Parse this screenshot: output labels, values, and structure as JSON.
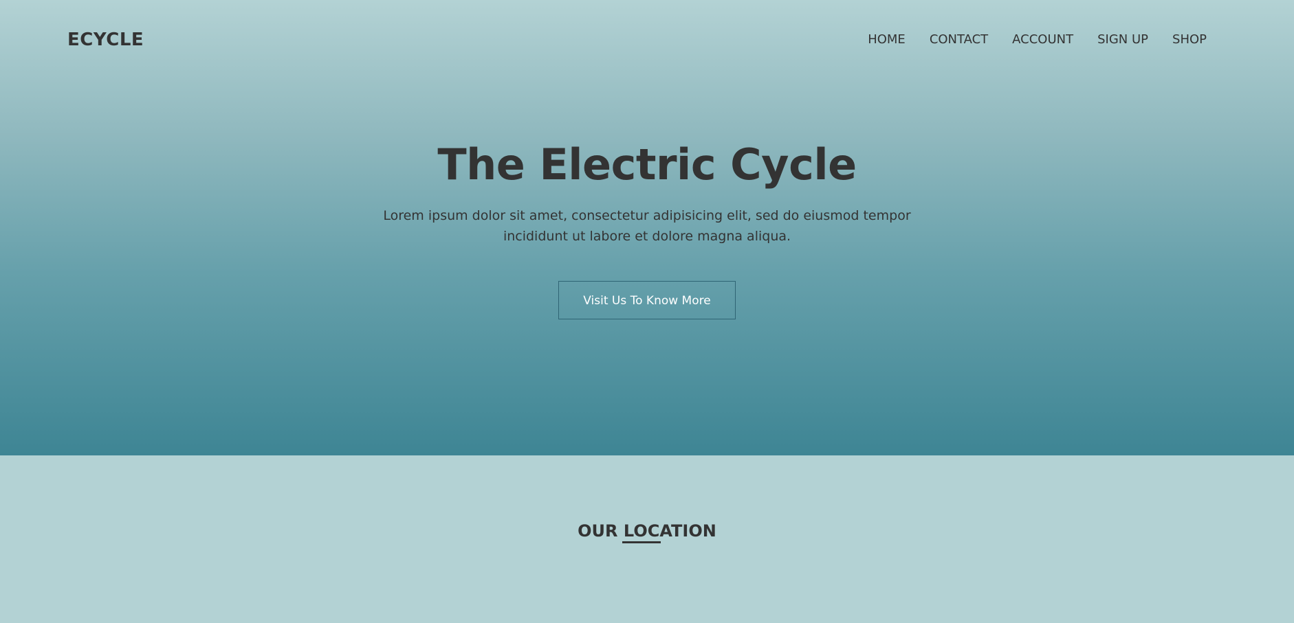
{
  "brand": {
    "logo": "ECYCLE"
  },
  "nav": {
    "items": [
      {
        "label": "HOME"
      },
      {
        "label": "CONTACT"
      },
      {
        "label": "ACCOUNT"
      },
      {
        "label": "SIGN UP"
      },
      {
        "label": "SHOP"
      }
    ]
  },
  "hero": {
    "title": "The Electric Cycle",
    "subtitle": "Lorem ipsum dolor sit amet, consectetur adipisicing elit, sed do eiusmod tempor incididunt ut labore et dolore magna aliqua.",
    "button_label": "Visit Us To Know More"
  },
  "location": {
    "title": "OUR LOCATION"
  },
  "colors": {
    "text": "#333333",
    "gradient_top": "#b3d2d4",
    "gradient_bottom": "#3e8594",
    "section_background": "#b3d2d4",
    "button_text": "#ffffff"
  }
}
